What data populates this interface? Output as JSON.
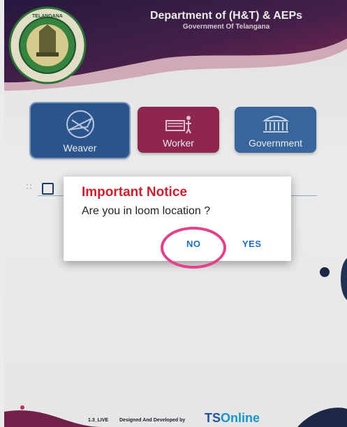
{
  "header": {
    "title": "Department of (H&T) & AEPs",
    "subtitle": "Government Of Telangana",
    "emblem_text": "GOVERNMENT OF TELANGANA"
  },
  "roles": [
    {
      "label": "Weaver",
      "icon": "loom-shuttle-icon",
      "color": "#2f5c9a"
    },
    {
      "label": "Worker",
      "icon": "worker-loom-icon",
      "color": "#9b2a57"
    },
    {
      "label": "Government",
      "icon": "government-building-icon",
      "color": "#3d6ea9"
    }
  ],
  "dialog": {
    "title": "Important Notice",
    "message": "Are you in loom location ?",
    "no_label": "NO",
    "yes_label": "YES",
    "highlight_color": "#e6408a"
  },
  "footer": {
    "version": "1.3_LIVE",
    "credit": "Designed And Developed by",
    "brand_part1": "TS",
    "brand_part2": "Online"
  },
  "colors": {
    "header_dark": "#2a1b44",
    "header_accent": "#8c2a57",
    "dialog_title": "#cc1f2d",
    "button_text": "#1f6fb8"
  }
}
